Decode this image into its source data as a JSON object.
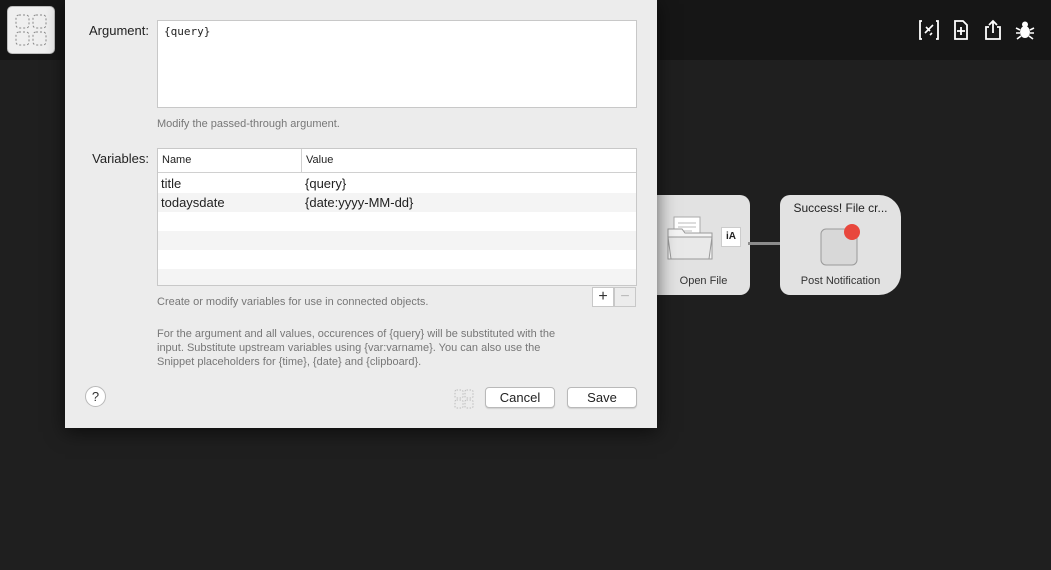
{
  "dialog": {
    "argument_label": "Argument:",
    "argument_value": "{query}",
    "argument_hint": "Modify the passed-through argument.",
    "variables_label": "Variables:",
    "table": {
      "col_name": "Name",
      "col_value": "Value",
      "rows": [
        {
          "name": "title",
          "value": "{query}"
        },
        {
          "name": "todaysdate",
          "value": "{date:yyyy-MM-dd}"
        }
      ]
    },
    "variables_hint": "Create or modify variables for use in connected objects.",
    "info_line1": "For the argument and all values, occurences of {query} will be substituted with the",
    "info_line2": "input. Substitute upstream variables using {var:varname}. You can also use the",
    "info_line3": "Snippet placeholders for {time}, {date} and {clipboard}.",
    "add_label": "+",
    "remove_label": "−",
    "help_label": "?",
    "cancel_label": "Cancel",
    "save_label": "Save"
  },
  "canvas": {
    "open_file_label": "Open File",
    "notification_title": "Success! File cr...",
    "notification_label": "Post Notification",
    "badge_text": "iA"
  },
  "toolbar": {
    "icons": [
      "variable-icon",
      "add-object-icon",
      "share-icon",
      "debug-icon"
    ]
  },
  "colors": {
    "canvas_bg": "#1f1f1f",
    "topbar_bg": "#161616",
    "dialog_bg": "#ececec",
    "node_bg": "#e2e2e2",
    "notification_red": "#e8473d"
  }
}
